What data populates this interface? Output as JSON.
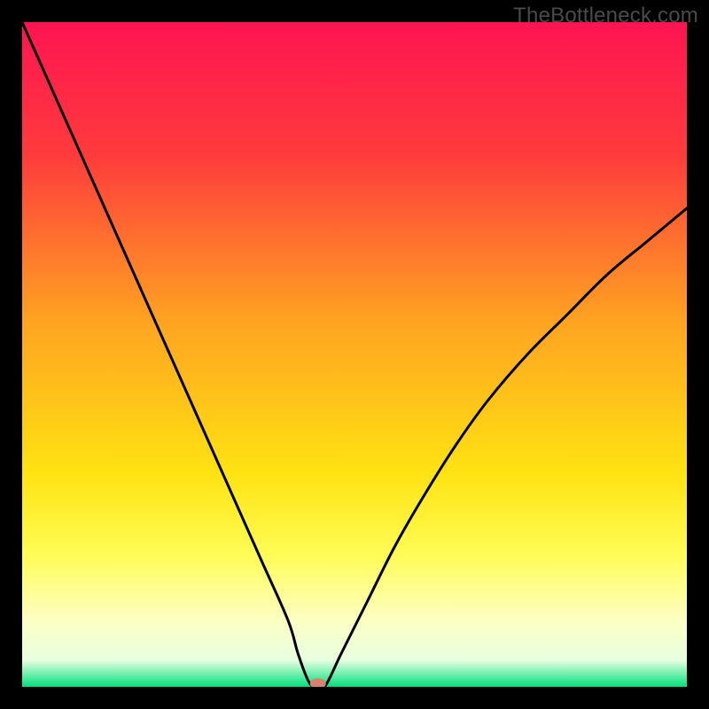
{
  "watermark": "TheBottleneck.com",
  "chart_data": {
    "type": "line",
    "title": "",
    "xlabel": "",
    "ylabel": "",
    "xlim": [
      0,
      100
    ],
    "ylim": [
      0,
      100
    ],
    "background_gradient": {
      "stops": [
        {
          "pos": 0,
          "color": "#ff1452"
        },
        {
          "pos": 20,
          "color": "#ff3b3c"
        },
        {
          "pos": 45,
          "color": "#ffa321"
        },
        {
          "pos": 68,
          "color": "#ffe312"
        },
        {
          "pos": 80,
          "color": "#fffc55"
        },
        {
          "pos": 90,
          "color": "#fdffc3"
        },
        {
          "pos": 96,
          "color": "#e8ffe0"
        },
        {
          "pos": 100,
          "color": "#00e07d"
        }
      ]
    },
    "series": [
      {
        "name": "bottleneck-curve",
        "x": [
          0,
          4,
          8,
          12,
          16,
          20,
          24,
          28,
          32,
          36,
          40,
          41.5,
          43,
          44,
          45.5,
          48,
          52,
          56,
          60,
          65,
          70,
          76,
          82,
          88,
          94,
          100
        ],
        "y": [
          100,
          91,
          82,
          73,
          64,
          55,
          46,
          37,
          28,
          19,
          10,
          5,
          1,
          0,
          0,
          5,
          13,
          21,
          28,
          36,
          43,
          50,
          56,
          62,
          67,
          72
        ]
      }
    ],
    "marker": {
      "name": "min-point",
      "x": 44.5,
      "y": 0.5,
      "color": "#d8816e"
    },
    "legend": null,
    "grid": false
  }
}
